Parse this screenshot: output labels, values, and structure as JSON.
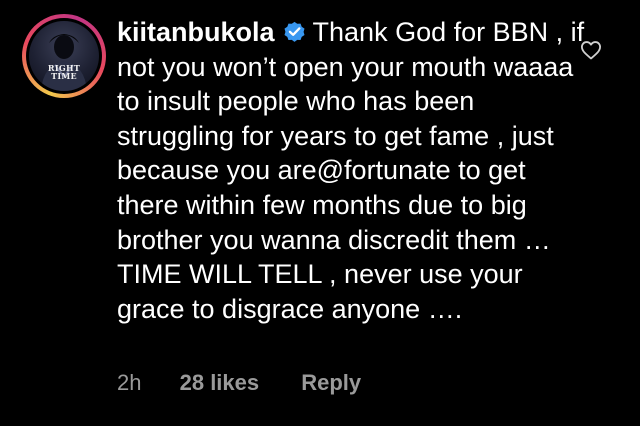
{
  "comment": {
    "username": "kiitanbukola",
    "verified": true,
    "text": "Thank God for BBN , if not you won’t open your mouth waaaa to insult people who has been struggling for years to get fame , just because you are@fortunate to get there within few months due to big brother you wanna discredit them … TIME WILL TELL , never use your grace to disgrace anyone ….",
    "avatar_caption_line1": "RIGHT",
    "avatar_caption_line2": "TIME",
    "timestamp": "2h",
    "likes": "28 likes",
    "reply_label": "Reply"
  },
  "icons": {
    "verified": "verified-badge-icon",
    "like": "heart-outline-icon"
  },
  "colors": {
    "background": "#000000",
    "text": "#ffffff",
    "meta": "#9a9a9a",
    "verified": "#3897f0"
  }
}
